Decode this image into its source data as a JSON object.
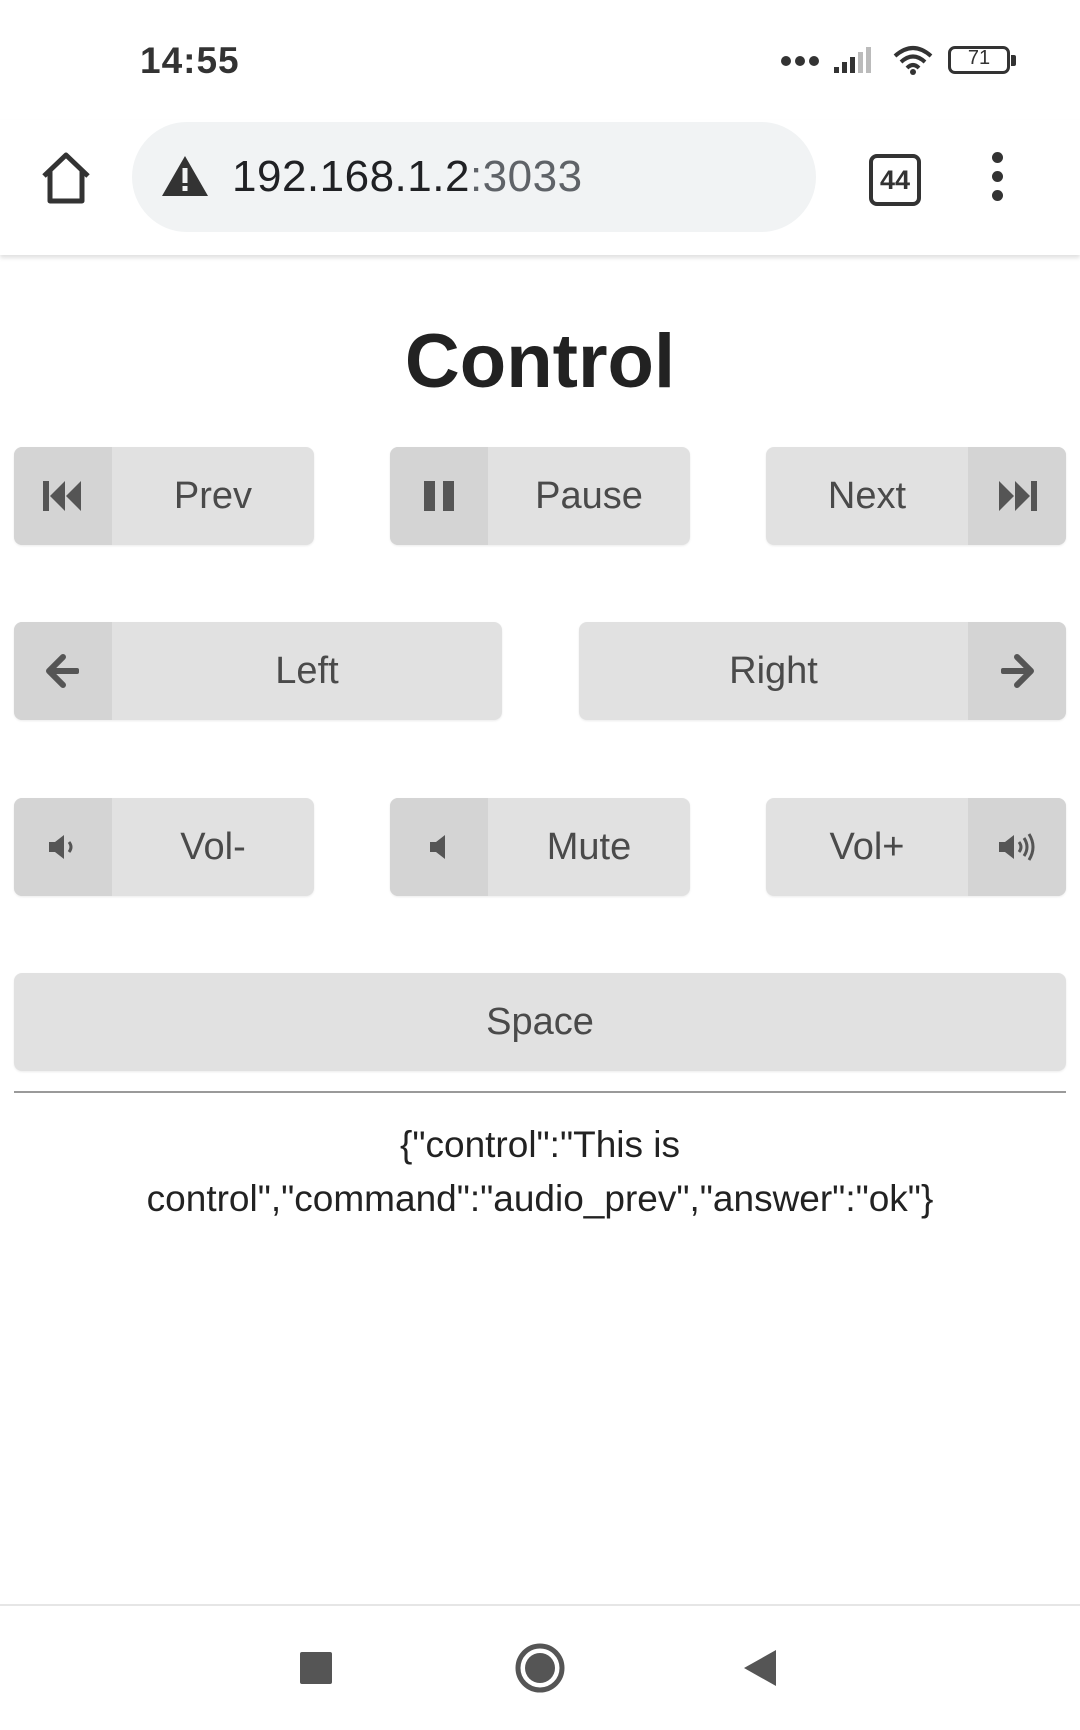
{
  "status_bar": {
    "time": "14:55",
    "battery": "71"
  },
  "browser": {
    "url_host": "192.168.1.2",
    "url_port": ":3033",
    "tab_count": "44"
  },
  "page": {
    "title": "Control",
    "buttons": {
      "prev": "Prev",
      "pause": "Pause",
      "next": "Next",
      "left": "Left",
      "right": "Right",
      "vol_down": "Vol-",
      "mute": "Mute",
      "vol_up": "Vol+",
      "space": "Space"
    },
    "response_line1": "{\"control\":\"This is",
    "response_line2": "control\",\"command\":\"audio_prev\",\"answer\":\"ok\"}"
  }
}
